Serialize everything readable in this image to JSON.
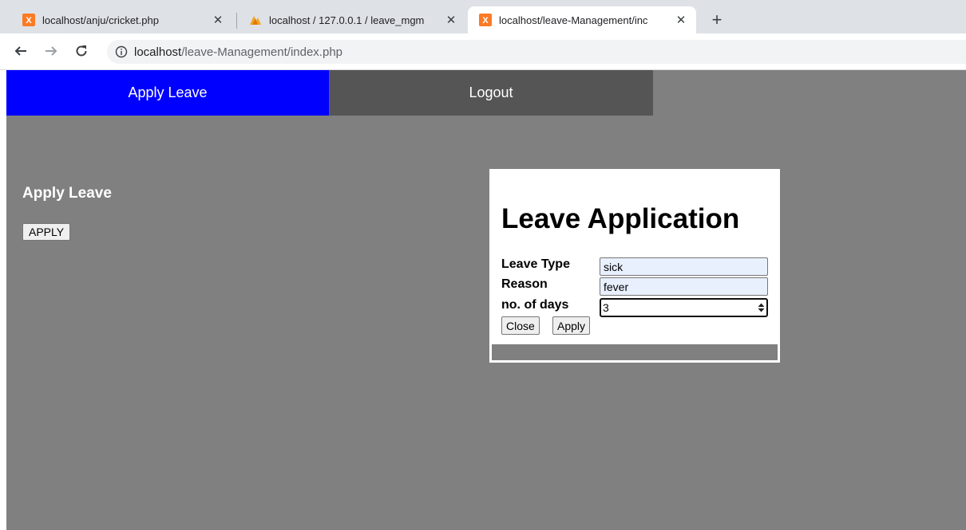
{
  "browser": {
    "tabs": [
      {
        "title": "localhost/anju/cricket.php",
        "icon": "xampp-icon",
        "active": false
      },
      {
        "title": "localhost / 127.0.0.1 / leave_mgm",
        "icon": "phpmyadmin-icon",
        "active": false
      },
      {
        "title": "localhost/leave-Management/inc",
        "icon": "xampp-icon",
        "active": true
      }
    ],
    "new_tab_symbol": "+",
    "close_symbol": "✕",
    "address": {
      "host": "localhost",
      "path": "/leave-Management/index.php"
    }
  },
  "nav": {
    "apply_label": "Apply Leave",
    "logout_label": "Logout"
  },
  "main": {
    "section_title": "Apply Leave",
    "apply_button": "APPLY"
  },
  "modal": {
    "title": "Leave Application",
    "leave_type_label": "Leave Type",
    "leave_type_value": "sick",
    "reason_label": "Reason",
    "reason_value": "fever",
    "days_label": "no. of days",
    "days_value": "3",
    "close_button": "Close",
    "apply_button": "Apply"
  },
  "colors": {
    "nav_active": "#0000ff",
    "nav_inactive": "#555555",
    "page_background": "#808080",
    "autofill_background": "#e8f0fe",
    "xampp_orange": "#fb7a24"
  }
}
